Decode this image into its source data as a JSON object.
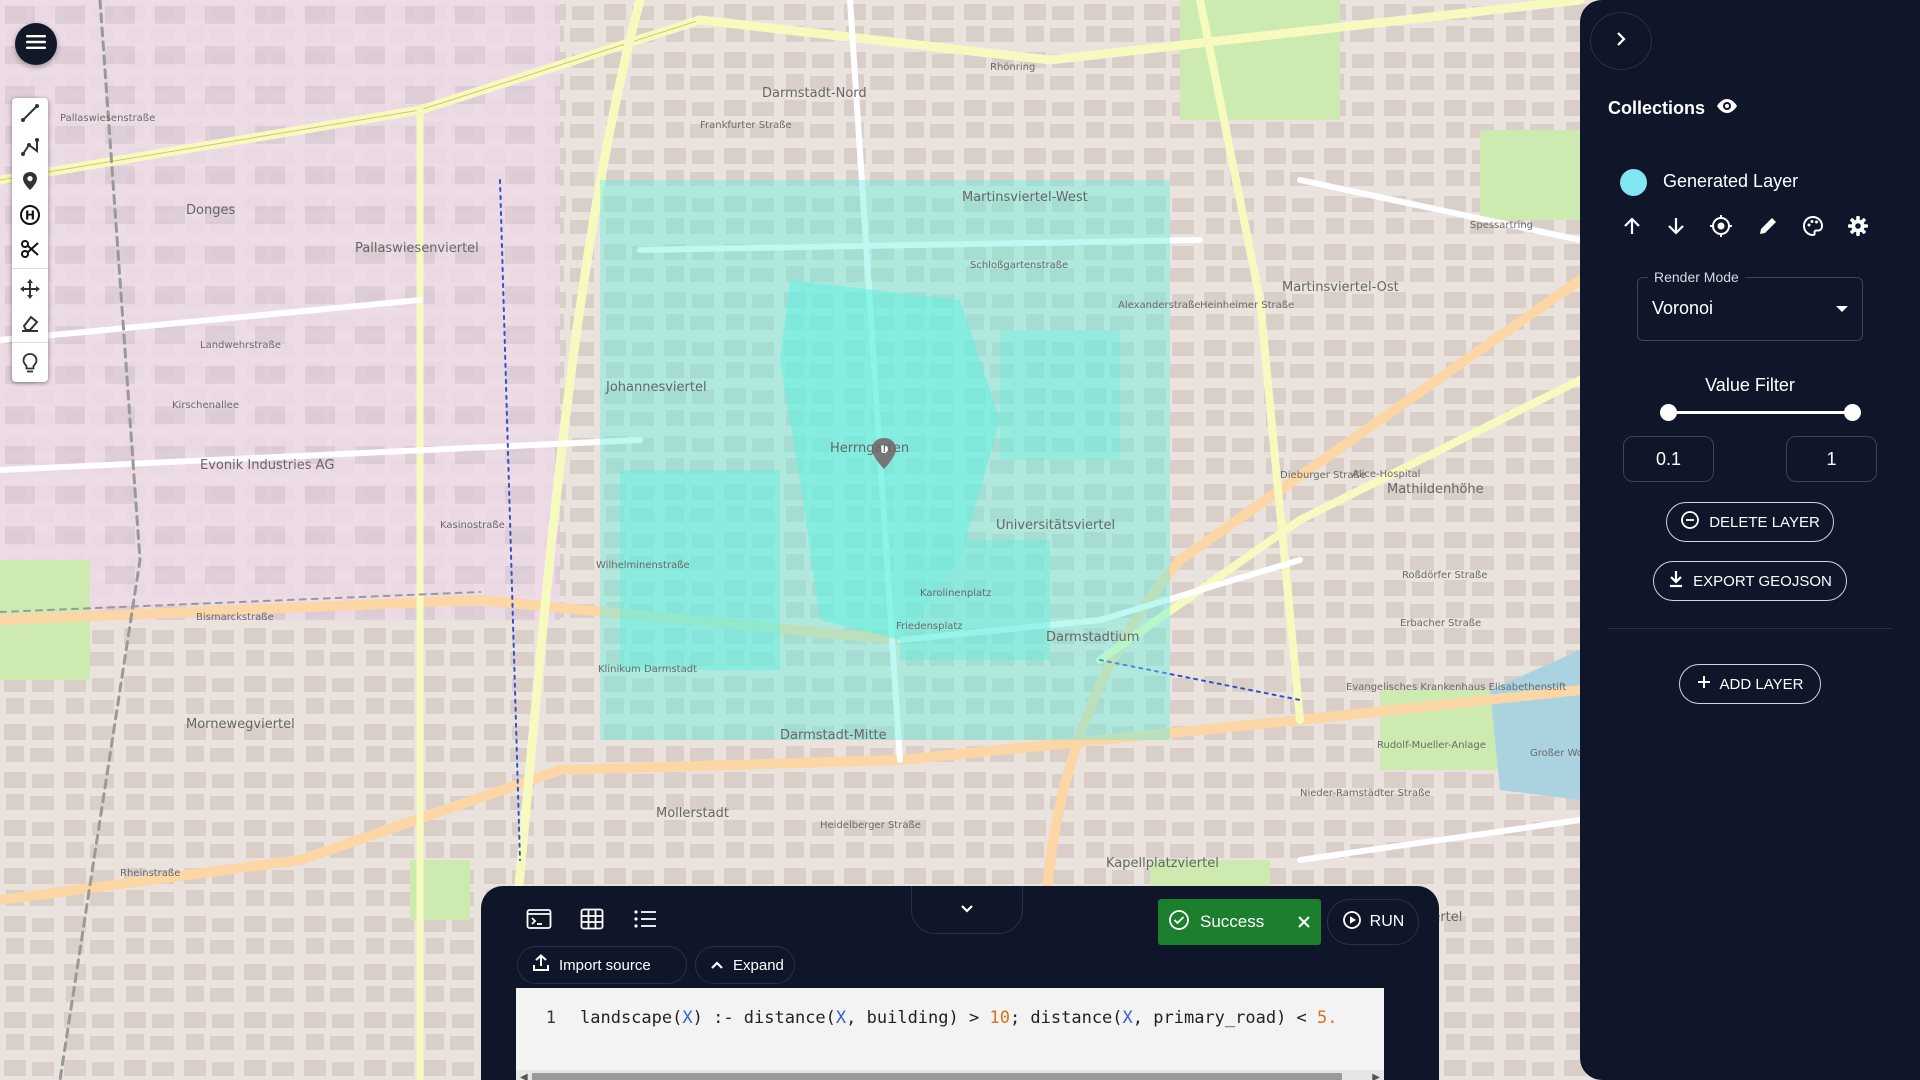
{
  "map": {
    "districts": [
      "Donges",
      "Pallaswiesenviertel",
      "Johannesviertel",
      "Evonik Industries AG",
      "Herrngarten",
      "Universitätsviertel",
      "Martinsviertel-West",
      "Martinsviertel-Ost",
      "Mathildenhöhe",
      "Darmstadt-Nord",
      "Darmstadtium",
      "Darmstadt-Mitte",
      "Mollerstadt",
      "Mornewegviertel",
      "Woogsviertel",
      "Kapellplatzviertel",
      "Karolinenplatz",
      "Friedensplatz",
      "Klinikum Darmstadt",
      "Alice-Hospital",
      "Großer Woog",
      "Rudolf-Mueller-Anlage",
      "Evangelisches Krankenhaus Elisabethenstift"
    ],
    "streets": [
      "Pallaswiesenstraße",
      "Landwehrstraße",
      "Bismarckstraße",
      "Rheinstraße",
      "Kasinostraße",
      "Frankfurter Straße",
      "Dieburger Straße",
      "Erbacher Straße",
      "Heinheimer Straße",
      "Kirschenallee",
      "Alexanderstraße",
      "Roßdörfer Straße",
      "Nieder-Ramstädter Straße",
      "Wilhelminenstraße",
      "Heidelberger Straße",
      "Rhönring",
      "Spessartring",
      "Schloßgartenstraße"
    ],
    "overlay_color": "#5ff0e0"
  },
  "menu": {
    "icon": "hamburger-icon"
  },
  "toolbar": {
    "tools": [
      "line-icon",
      "polyline-icon",
      "marker-icon",
      "hub-icon",
      "scissors-icon",
      "move-icon",
      "eraser-icon",
      "bulb-icon"
    ]
  },
  "panel": {
    "title": "Collections",
    "layer": {
      "name": "Generated Layer",
      "color": "#7fe6f2"
    },
    "render_mode": {
      "label": "Render Mode",
      "value": "Voronoi"
    },
    "value_filter": {
      "label": "Value Filter",
      "min": "0.1",
      "max": "1",
      "min_fraction": 0.0,
      "max_fraction": 1.0
    },
    "delete_label": "DELETE LAYER",
    "export_label": "EXPORT GEOJSON",
    "add_label": "ADD LAYER"
  },
  "console": {
    "import_label": "Import source",
    "expand_label": "Expand",
    "status": "Success",
    "run_label": "RUN",
    "line_number": "1",
    "code_tokens": [
      {
        "t": "landscape(",
        "c": ""
      },
      {
        "t": "X",
        "c": "tok-var"
      },
      {
        "t": ") :- distance(",
        "c": ""
      },
      {
        "t": "X",
        "c": "tok-var"
      },
      {
        "t": ", building) > ",
        "c": ""
      },
      {
        "t": "10",
        "c": "tok-num"
      },
      {
        "t": "; distance(",
        "c": ""
      },
      {
        "t": "X",
        "c": "tok-var"
      },
      {
        "t": ", primary_road) < ",
        "c": ""
      },
      {
        "t": "5.",
        "c": "tok-num"
      }
    ]
  }
}
